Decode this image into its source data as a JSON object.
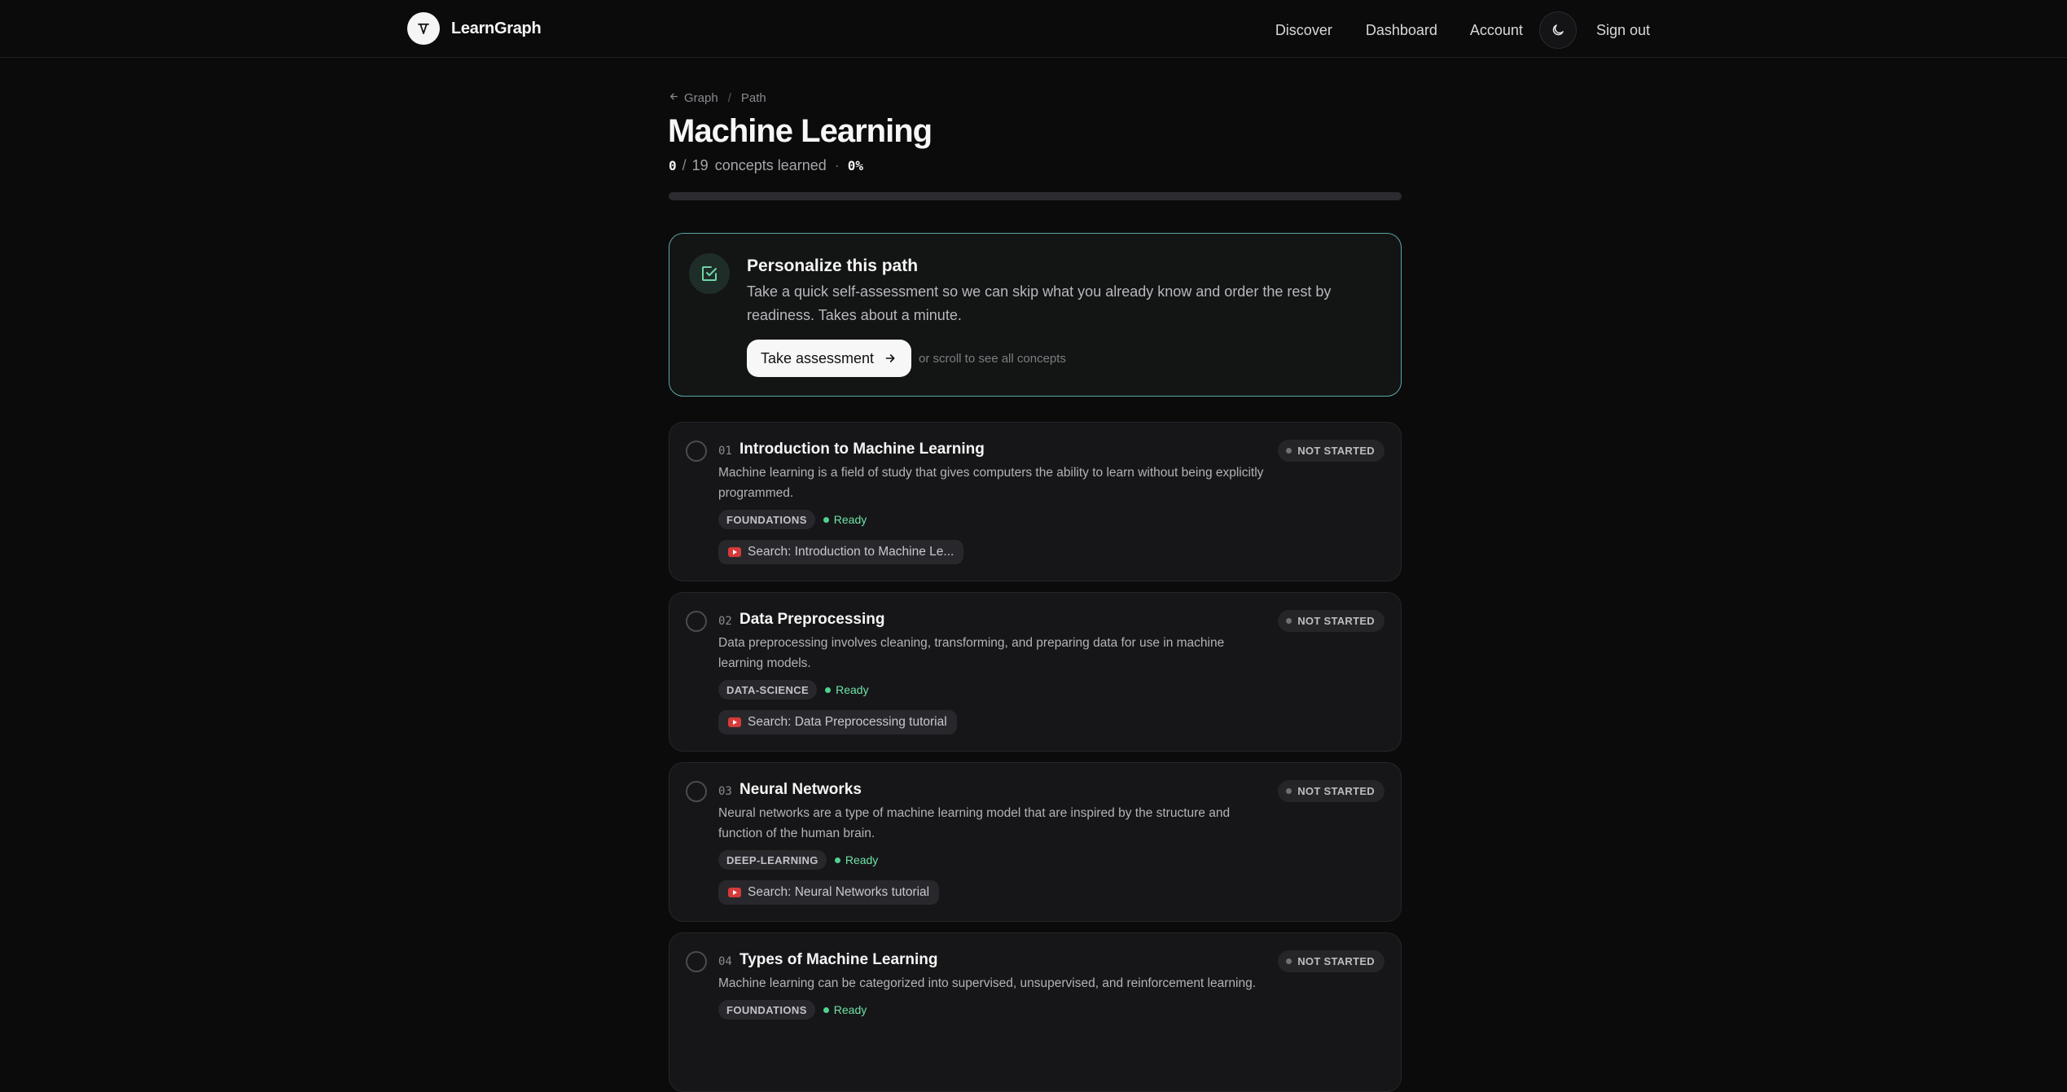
{
  "brand": {
    "name": "LearnGraph"
  },
  "nav": {
    "discover": "Discover",
    "dashboard": "Dashboard",
    "account": "Account",
    "signout": "Sign out"
  },
  "breadcrumb": {
    "graph": "Graph",
    "sep": "/",
    "path": "Path"
  },
  "path": {
    "title": "Machine Learning",
    "learned": "0",
    "slash": "/",
    "total": "19",
    "learned_label": "concepts learned",
    "dot": "·",
    "percent": "0%",
    "progress_fraction": 0
  },
  "assessment": {
    "title": "Personalize this path",
    "description": "Take a quick self-assessment so we can skip what you already know and order the rest by readiness. Takes about a minute.",
    "button": "Take assessment",
    "hint": "or scroll to see all concepts"
  },
  "concepts": [
    {
      "num": "01",
      "title": "Introduction to Machine Learning",
      "description": "Machine learning is a field of study that gives computers the ability to learn without being explicitly programmed.",
      "tag": "FOUNDATIONS",
      "readiness": "Ready",
      "status": "NOT STARTED",
      "video": "Search: Introduction to Machine Le..."
    },
    {
      "num": "02",
      "title": "Data Preprocessing",
      "description": "Data preprocessing involves cleaning, transforming, and preparing data for use in machine learning models.",
      "tag": "DATA-SCIENCE",
      "readiness": "Ready",
      "status": "NOT STARTED",
      "video": "Search: Data Preprocessing tutorial"
    },
    {
      "num": "03",
      "title": "Neural Networks",
      "description": "Neural networks are a type of machine learning model that are inspired by the structure and function of the human brain.",
      "tag": "DEEP-LEARNING",
      "readiness": "Ready",
      "status": "NOT STARTED",
      "video": "Search: Neural Networks tutorial"
    },
    {
      "num": "04",
      "title": "Types of Machine Learning",
      "description": "Machine learning can be categorized into supervised, unsupervised, and reinforcement learning.",
      "tag": "FOUNDATIONS",
      "readiness": "Ready",
      "status": "NOT STARTED"
    }
  ]
}
